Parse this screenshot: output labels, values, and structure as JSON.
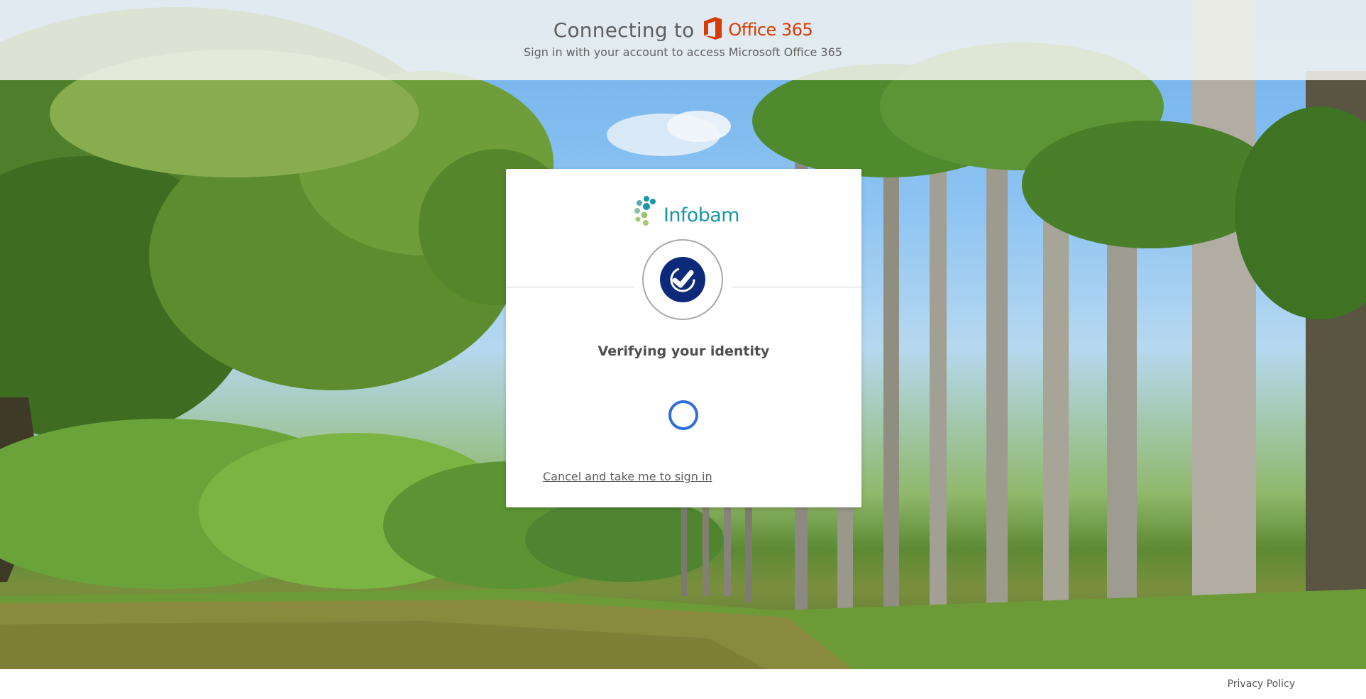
{
  "header": {
    "connecting_label": "Connecting to",
    "product_name": "Office 365",
    "subtitle": "Sign in with your account to access Microsoft Office 365"
  },
  "card": {
    "brand_name": "Infobam",
    "verify_title": "Verifying your identity",
    "cancel_link": "Cancel and take me to sign in"
  },
  "footer": {
    "privacy_link": "Privacy Policy"
  },
  "icons": {
    "office": "office-logo-icon",
    "brand": "infobam-dots-icon",
    "verify": "verified-check-icon",
    "loading": "loading-spinner-icon"
  },
  "colors": {
    "office_red": "#d83b01",
    "brand_teal": "#1796a6",
    "verify_navy": "#0d2a7a",
    "spinner_blue": "#2f6fd8"
  }
}
